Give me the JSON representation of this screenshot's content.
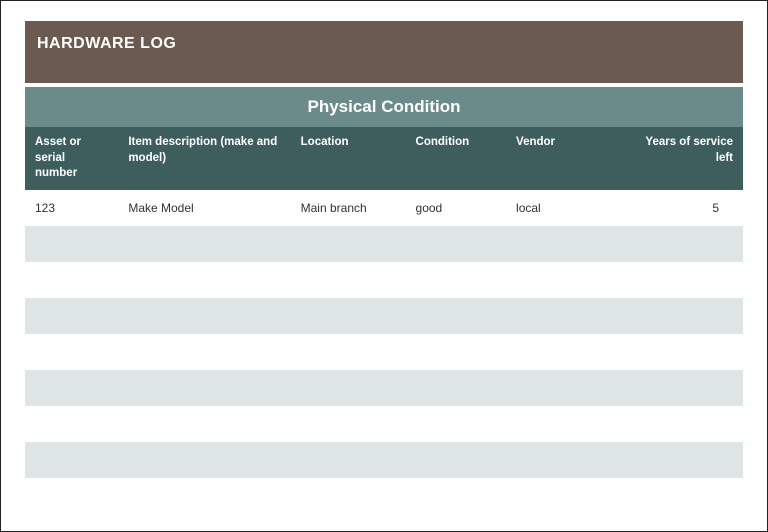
{
  "banner": {
    "title": "HARDWARE LOG"
  },
  "section": {
    "title": "Physical Condition"
  },
  "columns": {
    "asset": "Asset or serial number",
    "desc": "Item description (make and model)",
    "location": "Location",
    "condition": "Condition",
    "vendor": "Vendor",
    "years": "Years of service left"
  },
  "rows": [
    {
      "asset": "123",
      "desc": "Make Model",
      "location": "Main branch",
      "condition": "good",
      "vendor": "local",
      "years": "5"
    },
    {
      "asset": "",
      "desc": "",
      "location": "",
      "condition": "",
      "vendor": "",
      "years": ""
    },
    {
      "asset": "",
      "desc": "",
      "location": "",
      "condition": "",
      "vendor": "",
      "years": ""
    },
    {
      "asset": "",
      "desc": "",
      "location": "",
      "condition": "",
      "vendor": "",
      "years": ""
    },
    {
      "asset": "",
      "desc": "",
      "location": "",
      "condition": "",
      "vendor": "",
      "years": ""
    },
    {
      "asset": "",
      "desc": "",
      "location": "",
      "condition": "",
      "vendor": "",
      "years": ""
    },
    {
      "asset": "",
      "desc": "",
      "location": "",
      "condition": "",
      "vendor": "",
      "years": ""
    },
    {
      "asset": "",
      "desc": "",
      "location": "",
      "condition": "",
      "vendor": "",
      "years": ""
    },
    {
      "asset": "",
      "desc": "",
      "location": "",
      "condition": "",
      "vendor": "",
      "years": ""
    }
  ]
}
